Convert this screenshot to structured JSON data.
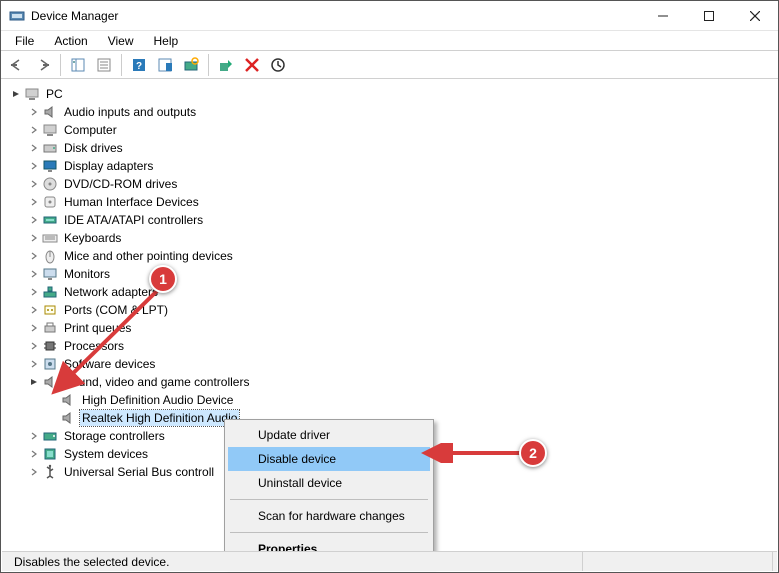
{
  "window": {
    "title": "Device Manager"
  },
  "menu": {
    "file": "File",
    "action": "Action",
    "view": "View",
    "help": "Help"
  },
  "tree": {
    "root": "PC",
    "items": [
      "Audio inputs and outputs",
      "Computer",
      "Disk drives",
      "Display adapters",
      "DVD/CD-ROM drives",
      "Human Interface Devices",
      "IDE ATA/ATAPI controllers",
      "Keyboards",
      "Mice and other pointing devices",
      "Monitors",
      "Network adapters",
      "Ports (COM & LPT)",
      "Print queues",
      "Processors",
      "Software devices"
    ],
    "sound_category": "Sound, video and game controllers",
    "sound_children": [
      "High Definition Audio Device",
      "Realtek High Definition Audio"
    ],
    "after": [
      "Storage controllers",
      "System devices",
      "Universal Serial Bus controll"
    ]
  },
  "context": {
    "update": "Update driver",
    "disable": "Disable device",
    "uninstall": "Uninstall device",
    "scan": "Scan for hardware changes",
    "properties": "Properties"
  },
  "status": {
    "text": "Disables the selected device."
  },
  "annotations": {
    "m1": "1",
    "m2": "2"
  }
}
